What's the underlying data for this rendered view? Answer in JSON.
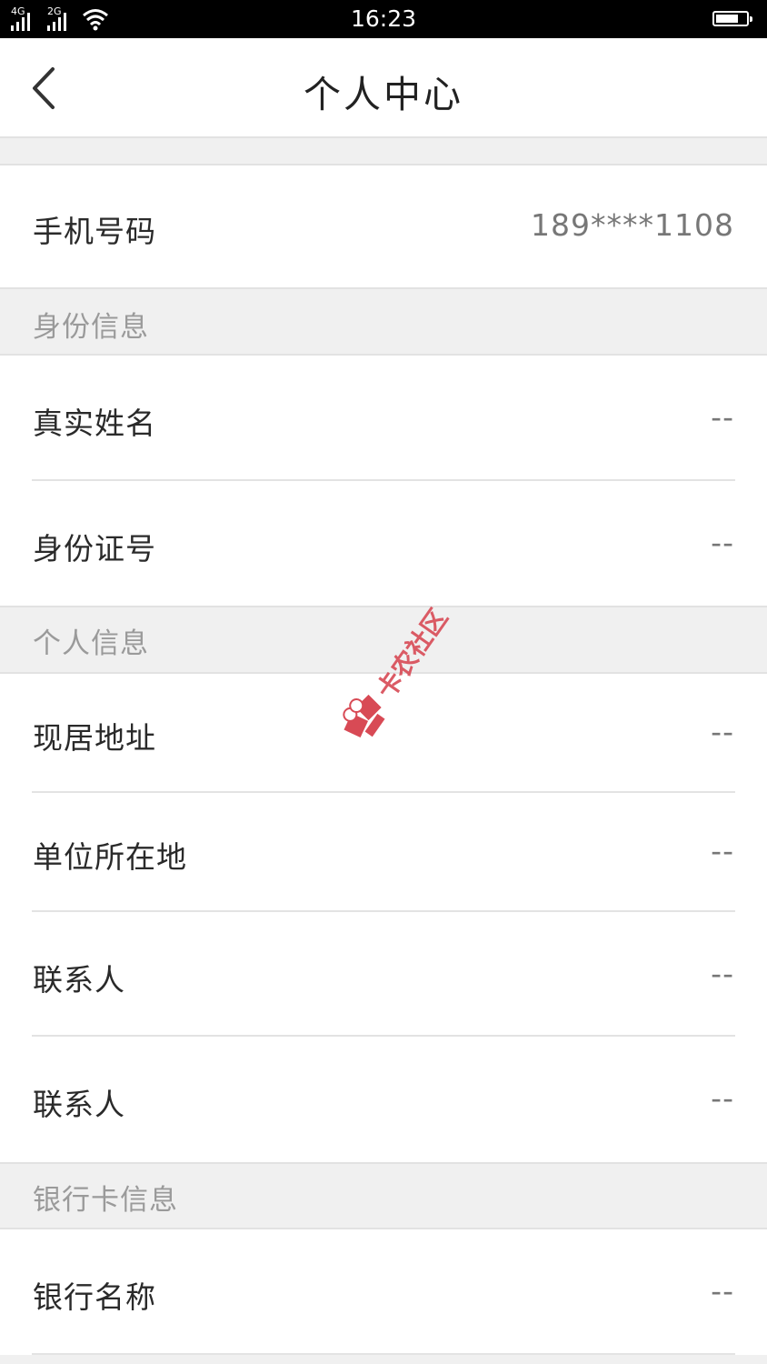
{
  "status_bar": {
    "network_1": "4G",
    "network_2": "2G",
    "time": "16:23",
    "icons": [
      "signal-icon",
      "wifi-icon",
      "battery-icon"
    ]
  },
  "header": {
    "title": "个人中心",
    "back_icon": "chevron-left-icon"
  },
  "phone": {
    "label": "手机号码",
    "value": "189****1108"
  },
  "sections": {
    "identity": "身份信息",
    "personal": "个人信息",
    "bank": "银行卡信息"
  },
  "identity": [
    {
      "label": "真实姓名",
      "value": "--"
    },
    {
      "label": "身份证号",
      "value": "--"
    }
  ],
  "personal": [
    {
      "label": "现居地址",
      "value": "--"
    },
    {
      "label": "单位所在地",
      "value": "--"
    },
    {
      "label": "联系人",
      "value": "--"
    },
    {
      "label": "联系人",
      "value": "--"
    }
  ],
  "bank": [
    {
      "label": "银行名称",
      "value": "--"
    }
  ],
  "watermark": {
    "text": "卡农社区",
    "color": "#d84a55"
  }
}
